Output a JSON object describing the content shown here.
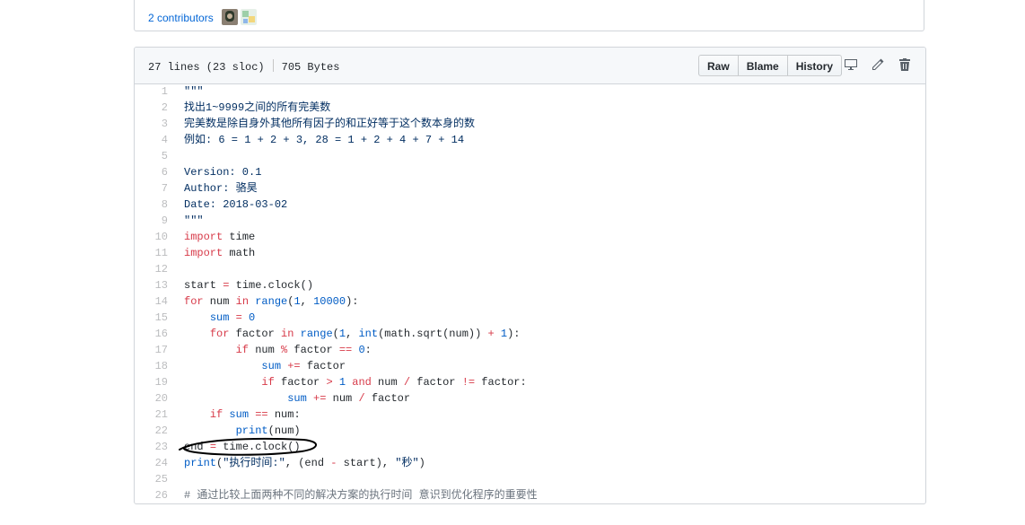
{
  "contributors": {
    "label": "2 contributors"
  },
  "file": {
    "lines_info": "27 lines (23 sloc)",
    "size": "705 Bytes",
    "buttons": {
      "raw": "Raw",
      "blame": "Blame",
      "history": "History"
    }
  },
  "code_lines": [
    {
      "n": "1",
      "tokens": [
        [
          "s",
          "\"\"\""
        ]
      ]
    },
    {
      "n": "2",
      "tokens": [
        [
          "s",
          "找出1~9999之间的所有完美数"
        ]
      ]
    },
    {
      "n": "3",
      "tokens": [
        [
          "s",
          "完美数是除自身外其他所有因子的和正好等于这个数本身的数"
        ]
      ]
    },
    {
      "n": "4",
      "tokens": [
        [
          "s",
          "例如: 6 = 1 + 2 + 3, 28 = 1 + 2 + 4 + 7 + 14"
        ]
      ]
    },
    {
      "n": "5",
      "tokens": []
    },
    {
      "n": "6",
      "tokens": [
        [
          "s",
          "Version: 0.1"
        ]
      ]
    },
    {
      "n": "7",
      "tokens": [
        [
          "s",
          "Author: 骆昊"
        ]
      ]
    },
    {
      "n": "8",
      "tokens": [
        [
          "s",
          "Date: 2018-03-02"
        ]
      ]
    },
    {
      "n": "9",
      "tokens": [
        [
          "s",
          "\"\"\""
        ]
      ]
    },
    {
      "n": "10",
      "tokens": [
        [
          "k",
          "import"
        ],
        [
          "",
          " time"
        ]
      ]
    },
    {
      "n": "11",
      "tokens": [
        [
          "k",
          "import"
        ],
        [
          "",
          " math"
        ]
      ]
    },
    {
      "n": "12",
      "tokens": []
    },
    {
      "n": "13",
      "tokens": [
        [
          "",
          "start "
        ],
        [
          "k",
          "="
        ],
        [
          "",
          " time.clock()"
        ]
      ]
    },
    {
      "n": "14",
      "tokens": [
        [
          "k",
          "for"
        ],
        [
          "",
          " num "
        ],
        [
          "k",
          "in"
        ],
        [
          "",
          " "
        ],
        [
          "c1",
          "range"
        ],
        [
          "",
          "("
        ],
        [
          "c1",
          "1"
        ],
        [
          "",
          ", "
        ],
        [
          "c1",
          "10000"
        ],
        [
          "",
          "):"
        ]
      ]
    },
    {
      "n": "15",
      "tokens": [
        [
          "",
          "    "
        ],
        [
          "c1",
          "sum"
        ],
        [
          "",
          " "
        ],
        [
          "k",
          "="
        ],
        [
          "",
          " "
        ],
        [
          "c1",
          "0"
        ]
      ]
    },
    {
      "n": "16",
      "tokens": [
        [
          "",
          "    "
        ],
        [
          "k",
          "for"
        ],
        [
          "",
          " factor "
        ],
        [
          "k",
          "in"
        ],
        [
          "",
          " "
        ],
        [
          "c1",
          "range"
        ],
        [
          "",
          "("
        ],
        [
          "c1",
          "1"
        ],
        [
          "",
          ", "
        ],
        [
          "c1",
          "int"
        ],
        [
          "",
          "(math.sqrt(num)) "
        ],
        [
          "k",
          "+"
        ],
        [
          "",
          " "
        ],
        [
          "c1",
          "1"
        ],
        [
          "",
          "):"
        ]
      ]
    },
    {
      "n": "17",
      "tokens": [
        [
          "",
          "        "
        ],
        [
          "k",
          "if"
        ],
        [
          "",
          " num "
        ],
        [
          "k",
          "%"
        ],
        [
          "",
          " factor "
        ],
        [
          "k",
          "=="
        ],
        [
          "",
          " "
        ],
        [
          "c1",
          "0"
        ],
        [
          "",
          ":"
        ]
      ]
    },
    {
      "n": "18",
      "tokens": [
        [
          "",
          "            "
        ],
        [
          "c1",
          "sum"
        ],
        [
          "",
          " "
        ],
        [
          "k",
          "+="
        ],
        [
          "",
          " factor"
        ]
      ]
    },
    {
      "n": "19",
      "tokens": [
        [
          "",
          "            "
        ],
        [
          "k",
          "if"
        ],
        [
          "",
          " factor "
        ],
        [
          "k",
          ">"
        ],
        [
          "",
          " "
        ],
        [
          "c1",
          "1"
        ],
        [
          "",
          " "
        ],
        [
          "k",
          "and"
        ],
        [
          "",
          " num "
        ],
        [
          "k",
          "/"
        ],
        [
          "",
          " factor "
        ],
        [
          "k",
          "!="
        ],
        [
          "",
          " factor:"
        ]
      ]
    },
    {
      "n": "20",
      "tokens": [
        [
          "",
          "                "
        ],
        [
          "c1",
          "sum"
        ],
        [
          "",
          " "
        ],
        [
          "k",
          "+="
        ],
        [
          "",
          " num "
        ],
        [
          "k",
          "/"
        ],
        [
          "",
          " factor"
        ]
      ]
    },
    {
      "n": "21",
      "tokens": [
        [
          "",
          "    "
        ],
        [
          "k",
          "if"
        ],
        [
          "",
          " "
        ],
        [
          "c1",
          "sum"
        ],
        [
          "",
          " "
        ],
        [
          "k",
          "=="
        ],
        [
          "",
          " num:"
        ]
      ]
    },
    {
      "n": "22",
      "tokens": [
        [
          "",
          "        "
        ],
        [
          "c1",
          "print"
        ],
        [
          "",
          "(num)"
        ]
      ]
    },
    {
      "n": "23",
      "tokens": [
        [
          "",
          "end "
        ],
        [
          "k",
          "="
        ],
        [
          "",
          " time.clock()"
        ]
      ]
    },
    {
      "n": "24",
      "tokens": [
        [
          "c1",
          "print"
        ],
        [
          "",
          "("
        ],
        [
          "s",
          "\"执行时间:\""
        ],
        [
          "",
          ", (end "
        ],
        [
          "k",
          "-"
        ],
        [
          "",
          " start), "
        ],
        [
          "s",
          "\"秒\""
        ],
        [
          "",
          ")"
        ]
      ]
    },
    {
      "n": "25",
      "tokens": []
    },
    {
      "n": "26",
      "tokens": [
        [
          "cm",
          "# 通过比较上面两种不同的解决方案的执行时间 意识到优化程序的重要性"
        ]
      ]
    }
  ],
  "icons": [
    "desktop-icon",
    "pencil-icon",
    "trashcan-icon"
  ],
  "colors": {
    "link": "#0366d6",
    "keyword": "#d73a49",
    "string": "#032f62",
    "constant": "#005cc5",
    "comment": "#6a737d"
  }
}
